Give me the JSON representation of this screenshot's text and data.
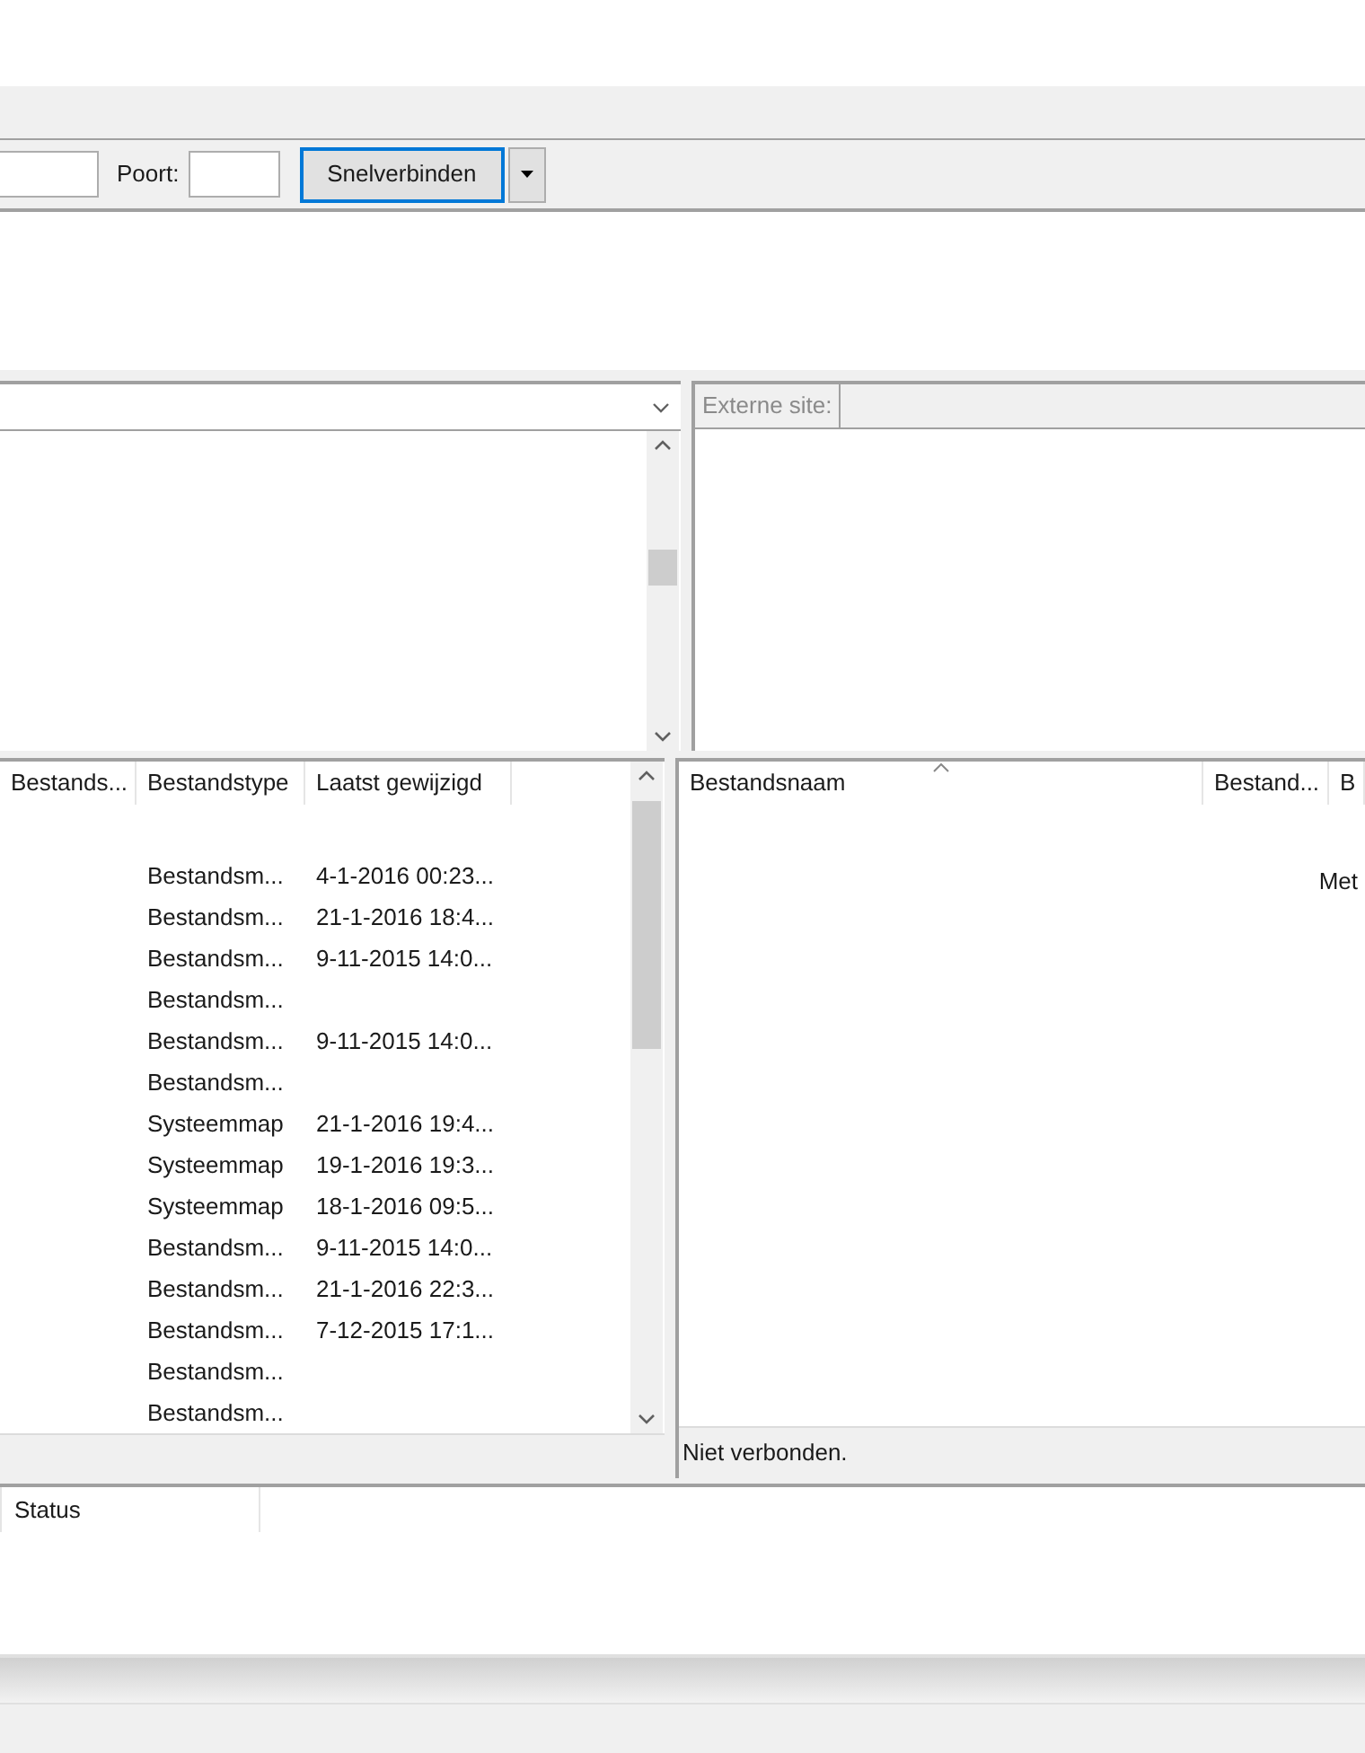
{
  "quickconnect": {
    "port_label": "Poort:",
    "connect_button": "Snelverbinden"
  },
  "remote_site": {
    "label": "Externe site:"
  },
  "local_list": {
    "columns": [
      "Bestands...",
      "Bestandstype",
      "Laatst gewijzigd"
    ],
    "rows": [
      {
        "type": "Bestandsm...",
        "modified": "4-1-2016 00:23..."
      },
      {
        "type": "Bestandsm...",
        "modified": "21-1-2016 18:4..."
      },
      {
        "type": "Bestandsm...",
        "modified": "9-11-2015 14:0..."
      },
      {
        "type": "Bestandsm...",
        "modified": ""
      },
      {
        "type": "Bestandsm...",
        "modified": "9-11-2015 14:0..."
      },
      {
        "type": "Bestandsm...",
        "modified": ""
      },
      {
        "type": "Systeemmap",
        "modified": "21-1-2016 19:4..."
      },
      {
        "type": "Systeemmap",
        "modified": "19-1-2016 19:3..."
      },
      {
        "type": "Systeemmap",
        "modified": "18-1-2016 09:5..."
      },
      {
        "type": "Bestandsm...",
        "modified": "9-11-2015 14:0..."
      },
      {
        "type": "Bestandsm...",
        "modified": "21-1-2016 22:3..."
      },
      {
        "type": "Bestandsm...",
        "modified": "7-12-2015 17:1..."
      },
      {
        "type": "Bestandsm...",
        "modified": ""
      },
      {
        "type": "Bestandsm...",
        "modified": ""
      }
    ]
  },
  "remote_list": {
    "columns": [
      "Bestandsnaam",
      "Bestand...",
      "B"
    ],
    "message": "Met",
    "status": "Niet verbonden."
  },
  "queue": {
    "columns": [
      "Status"
    ]
  }
}
